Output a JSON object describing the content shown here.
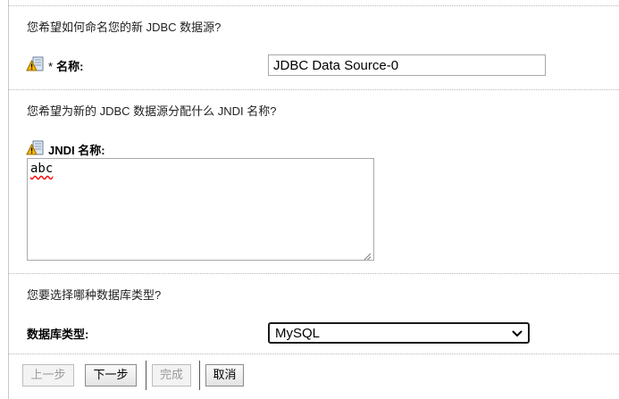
{
  "form": {
    "name_question": "您希望如何命名您的新 JDBC 数据源?",
    "name_required_mark": "*",
    "name_label": "名称:",
    "name_value": "JDBC Data Source-0",
    "jndi_question": "您希望为新的 JDBC 数据源分配什么 JNDI 名称?",
    "jndi_label": "JNDI 名称:",
    "jndi_value": "abc",
    "dbtype_question": "您要选择哪种数据库类型?",
    "dbtype_label": "数据库类型:",
    "dbtype_value": "MySQL"
  },
  "buttons": {
    "back": "上一步",
    "next": "下一步",
    "finish": "完成",
    "cancel": "取消"
  },
  "icons": {
    "help": "help-info-icon",
    "dropdown": "chevron-down-icon",
    "resize": "resize-grip-icon"
  },
  "colors": {
    "separator": "#b8b8b8",
    "disabled_text": "#9a9a9a",
    "spell_underline": "#ff0000",
    "help_icon_fill": "#f5b800"
  }
}
